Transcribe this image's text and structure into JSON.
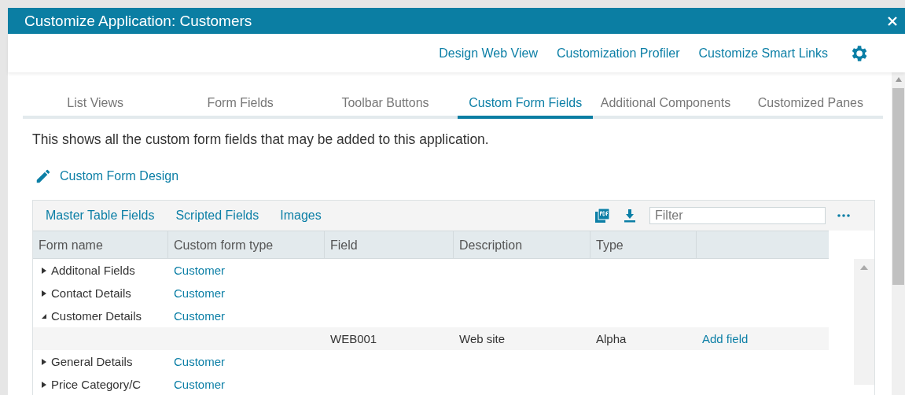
{
  "window": {
    "title": "Customize Application: Customers"
  },
  "header_links": [
    "Design Web View",
    "Customization Profiler",
    "Customize Smart Links"
  ],
  "tabs": [
    {
      "label": "List Views",
      "selected": false
    },
    {
      "label": "Form Fields",
      "selected": false
    },
    {
      "label": "Toolbar Buttons",
      "selected": false
    },
    {
      "label": "Custom Form Fields",
      "selected": true
    },
    {
      "label": "Additional Components",
      "selected": false
    },
    {
      "label": "Customized Panes",
      "selected": false
    }
  ],
  "description": "This shows all the custom form fields that may be added to this application.",
  "design_link": "Custom Form Design",
  "table": {
    "subtabs": [
      "Master Table Fields",
      "Scripted Fields",
      "Images"
    ],
    "filter": {
      "placeholder": "Filter"
    },
    "columns": [
      "Form name",
      "Custom form type",
      "Field",
      "Description",
      "Type"
    ],
    "rows": [
      {
        "name": "Additonal Fields",
        "type": "Customer",
        "expanded": false,
        "children": []
      },
      {
        "name": "Contact Details",
        "type": "Customer",
        "expanded": false,
        "children": []
      },
      {
        "name": "Customer Details",
        "type": "Customer",
        "expanded": true,
        "children": [
          {
            "field": "WEB001",
            "description": "Web site",
            "type": "Alpha",
            "action": "Add field"
          }
        ]
      },
      {
        "name": "General Details",
        "type": "Customer",
        "expanded": false,
        "children": []
      },
      {
        "name": "Price Category/C",
        "type": "Customer",
        "expanded": false,
        "children": []
      }
    ]
  }
}
